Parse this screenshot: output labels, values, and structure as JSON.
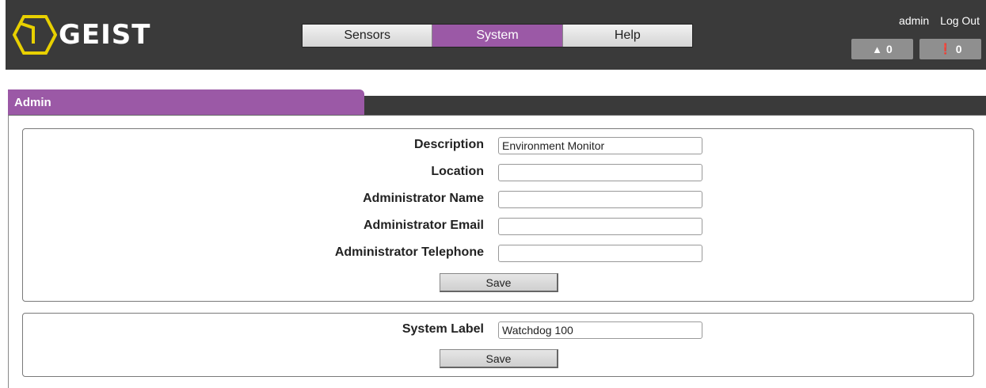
{
  "header": {
    "logo_text": "GEIST",
    "nav": [
      {
        "label": "Sensors",
        "active": false
      },
      {
        "label": "System",
        "active": true
      },
      {
        "label": "Help",
        "active": false
      }
    ],
    "user": "admin",
    "logout_label": "Log Out",
    "alarm_count": "0",
    "warning_count": "0"
  },
  "panel": {
    "title": "Admin"
  },
  "admin_form": {
    "fields": [
      {
        "label": "Description",
        "value": "Environment Monitor"
      },
      {
        "label": "Location",
        "value": ""
      },
      {
        "label": "Administrator Name",
        "value": ""
      },
      {
        "label": "Administrator Email",
        "value": ""
      },
      {
        "label": "Administrator Telephone",
        "value": ""
      }
    ],
    "save_label": "Save"
  },
  "label_form": {
    "label": "System Label",
    "value": "Watchdog 100",
    "save_label": "Save"
  },
  "colors": {
    "accent": "#9b59a6",
    "header_bg": "#3a3a3a",
    "logo_yellow": "#e8d000"
  }
}
